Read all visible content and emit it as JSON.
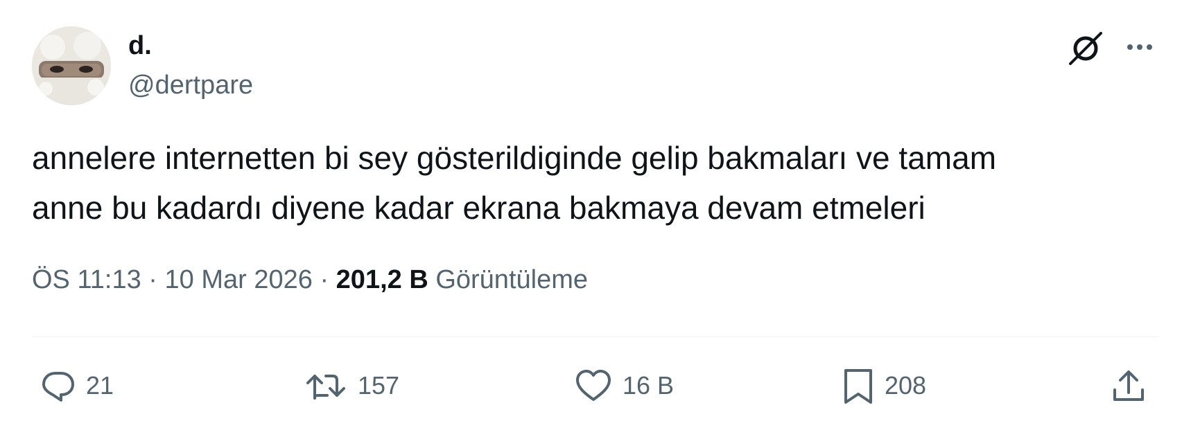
{
  "author": {
    "display_name": "d.",
    "handle": "@dertpare"
  },
  "tweet": {
    "text": "annelere internetten bi sey gösterildiginde gelip bakmaları ve tamam\nanne bu kadardı diyene kadar ekrana bakmaya devam etmeleri"
  },
  "meta": {
    "time": "ÖS 11:13",
    "separator": "·",
    "date": "10 Mar 2026",
    "views_count": "201,2 B",
    "views_label": "Görüntüleme"
  },
  "actions": {
    "replies": "21",
    "retweets": "157",
    "likes": "16 B",
    "bookmarks": "208"
  },
  "icons": {
    "grok": "grok-icon",
    "more": "more-icon",
    "reply": "reply-icon",
    "retweet": "retweet-icon",
    "like": "heart-icon",
    "bookmark": "bookmark-icon",
    "share": "share-icon"
  },
  "colors": {
    "text_primary": "#0f1419",
    "text_secondary": "#536471",
    "divider": "#eff3f4"
  }
}
